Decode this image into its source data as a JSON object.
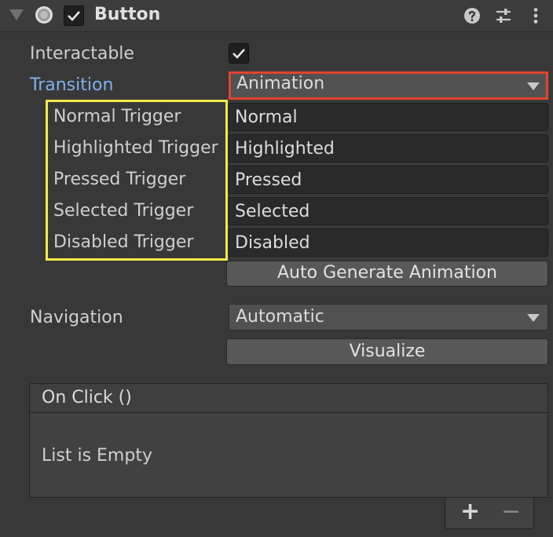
{
  "header": {
    "title": "Button",
    "enabled_checked": true,
    "icons": [
      "foldout-arrow-icon",
      "object-icon",
      "help-icon",
      "preset-icon",
      "more-icon"
    ]
  },
  "interactable": {
    "label": "Interactable",
    "checked": true
  },
  "transition": {
    "label": "Transition",
    "value": "Animation"
  },
  "triggers": [
    {
      "label": "Normal Trigger",
      "value": "Normal"
    },
    {
      "label": "Highlighted Trigger",
      "value": "Highlighted"
    },
    {
      "label": "Pressed Trigger",
      "value": "Pressed"
    },
    {
      "label": "Selected Trigger",
      "value": "Selected"
    },
    {
      "label": "Disabled Trigger",
      "value": "Disabled"
    }
  ],
  "auto_generate": {
    "label": "Auto Generate Animation"
  },
  "navigation": {
    "label": "Navigation",
    "value": "Automatic"
  },
  "visualize": {
    "label": "Visualize"
  },
  "on_click": {
    "title": "On Click ()",
    "empty_text": "List is Empty",
    "add_label": "+",
    "remove_label": "−"
  },
  "colors": {
    "highlight_red": "#e5432f",
    "highlight_yellow": "#f5ea4a",
    "label_blue": "#7fb0ee"
  }
}
